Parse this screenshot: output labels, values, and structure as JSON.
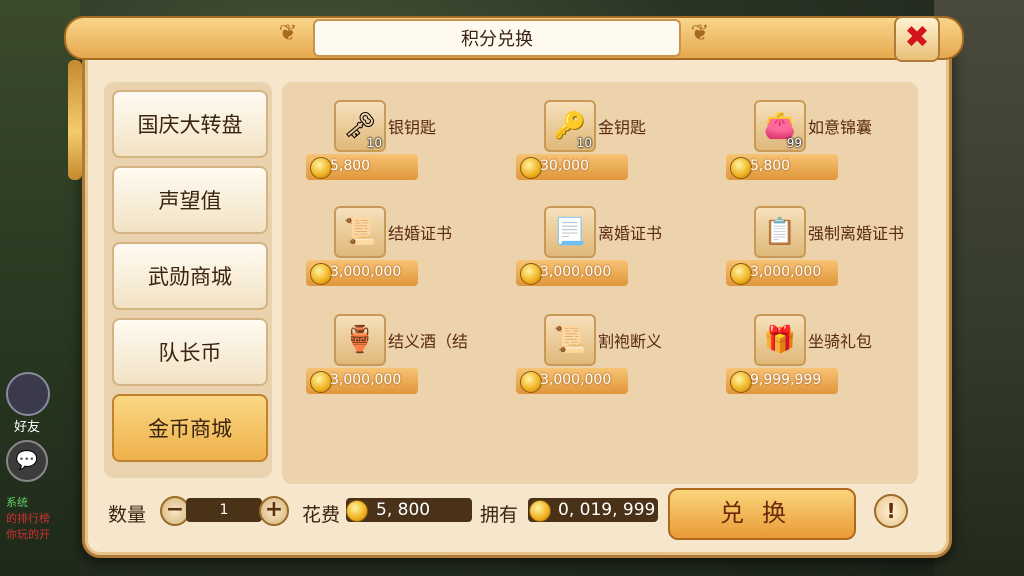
{
  "dialog": {
    "title": "积分兑换",
    "close_glyph": "✖"
  },
  "sidebar": {
    "items": [
      {
        "label": "国庆大转盘",
        "active": false
      },
      {
        "label": "声望值",
        "active": false
      },
      {
        "label": "武勋商城",
        "active": false
      },
      {
        "label": "队长币",
        "active": false
      },
      {
        "label": "金币商城",
        "active": true
      }
    ]
  },
  "items": [
    {
      "name": "银钥匙",
      "price": "5,800",
      "badge": "10",
      "icon": "silver-key-icon",
      "glyph": "🗝"
    },
    {
      "name": "金钥匙",
      "price": "30,000",
      "badge": "10",
      "icon": "gold-key-icon",
      "glyph": "🔑"
    },
    {
      "name": "如意锦囊",
      "price": "5,800",
      "badge": "99",
      "icon": "pouch-icon",
      "glyph": "👛"
    },
    {
      "name": "结婚证书",
      "price": "3,000,000",
      "badge": "",
      "icon": "marriage-scroll-icon",
      "glyph": "📜"
    },
    {
      "name": "离婚证书",
      "price": "3,000,000",
      "badge": "",
      "icon": "divorce-scroll-icon",
      "glyph": "📃"
    },
    {
      "name": "强制离婚证书",
      "price": "3,000,000",
      "badge": "",
      "icon": "forced-divorce-certificate-icon",
      "glyph": "📋"
    },
    {
      "name": "结义酒（结",
      "price": "3,000,000",
      "badge": "",
      "icon": "wine-jar-icon",
      "glyph": "🏺"
    },
    {
      "name": "割袍断义",
      "price": "3,000,000",
      "badge": "",
      "icon": "cut-robe-scroll-icon",
      "glyph": "📜"
    },
    {
      "name": "坐骑礼包",
      "price": "9,999,999",
      "badge": "",
      "icon": "mount-gift-pack-icon",
      "glyph": "🎁"
    }
  ],
  "footer": {
    "qty_label": "数量",
    "qty_value": "1",
    "minus": "−",
    "plus": "+",
    "cost_label": "花费",
    "cost_value": "5, 800",
    "owned_label": "拥有",
    "owned_value": "0, 019, 999",
    "exchange_label": "兑换",
    "info_glyph": "!"
  },
  "hud": {
    "friend_label": "好友",
    "chat_lines": [
      "系统",
      "的排行榜",
      "你玩的开"
    ]
  },
  "colors": {
    "accent": "#e9a94c",
    "panel": "#f6e7cc",
    "close": "#d4141c"
  }
}
